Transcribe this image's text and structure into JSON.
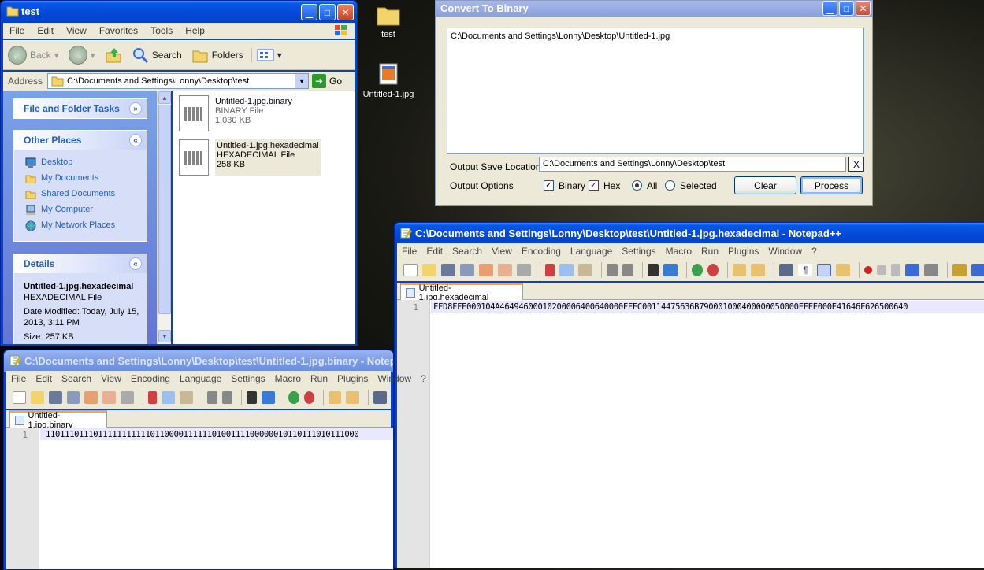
{
  "desktop": {
    "icons": [
      {
        "label": "test",
        "icon": "folder-icon"
      },
      {
        "label": "Untitled-1.jpg",
        "icon": "jpg-file-icon"
      }
    ]
  },
  "explorer": {
    "title": "test",
    "menu": [
      "File",
      "Edit",
      "View",
      "Favorites",
      "Tools",
      "Help"
    ],
    "toolbar": {
      "back": "Back",
      "search": "Search",
      "folders": "Folders"
    },
    "address": {
      "label": "Address",
      "value": "C:\\Documents and Settings\\Lonny\\Desktop\\test",
      "go": "Go"
    },
    "tasks": {
      "file_folder_tasks": "File and Folder Tasks",
      "other_places": "Other Places",
      "places": [
        "Desktop",
        "My Documents",
        "Shared Documents",
        "My Computer",
        "My Network Places"
      ],
      "details": "Details",
      "details_name": "Untitled-1.jpg.hexadecimal",
      "details_type": "HEXADECIMAL File",
      "details_modified": "Date Modified: Today, July 15, 2013, 3:11 PM",
      "details_size": "Size: 257 KB"
    },
    "files": [
      {
        "name": "Untitled-1.jpg.binary",
        "type": "BINARY File",
        "size": "1,030 KB"
      },
      {
        "name": "Untitled-1.jpg.hexadecimal",
        "type": "HEXADECIMAL File",
        "size": "258 KB"
      }
    ]
  },
  "converter": {
    "title": "Convert To Binary",
    "file_list": "C:\\Documents and Settings\\Lonny\\Desktop\\Untitled-1.jpg",
    "output_label": "Output Save Location",
    "output_value": "C:\\Documents and Settings\\Lonny\\Desktop\\test",
    "clear_x": "X",
    "options_label": "Output Options",
    "binary_label": "Binary",
    "hex_label": "Hex",
    "all_label": "All",
    "selected_label": "Selected",
    "binary_checked": true,
    "hex_checked": true,
    "scope": "All",
    "clear_button": "Clear",
    "process_button": "Process"
  },
  "npp_hex": {
    "title": "C:\\Documents and Settings\\Lonny\\Desktop\\test\\Untitled-1.jpg.hexadecimal - Notepad++",
    "menu": [
      "File",
      "Edit",
      "Search",
      "View",
      "Encoding",
      "Language",
      "Settings",
      "Macro",
      "Run",
      "Plugins",
      "Window",
      "?"
    ],
    "tab": "Untitled-1.jpg.hexadecimal",
    "line_no": "1",
    "content": "FFD8FFE000104A46494600010200006400640000FFEC00114475636B790001000400000050000FFEE000E41646F626500640"
  },
  "npp_bin": {
    "title": "C:\\Documents and Settings\\Lonny\\Desktop\\test\\Untitled-1.jpg.binary - Notepad++",
    "menu": [
      "File",
      "Edit",
      "Search",
      "View",
      "Encoding",
      "Language",
      "Settings",
      "Macro",
      "Run",
      "Plugins",
      "Window",
      "?"
    ],
    "tab": "Untitled-1.jpg.binary",
    "line_no": "1",
    "content": "110111011101111111111101100001111110100111100000010110111010111000"
  }
}
